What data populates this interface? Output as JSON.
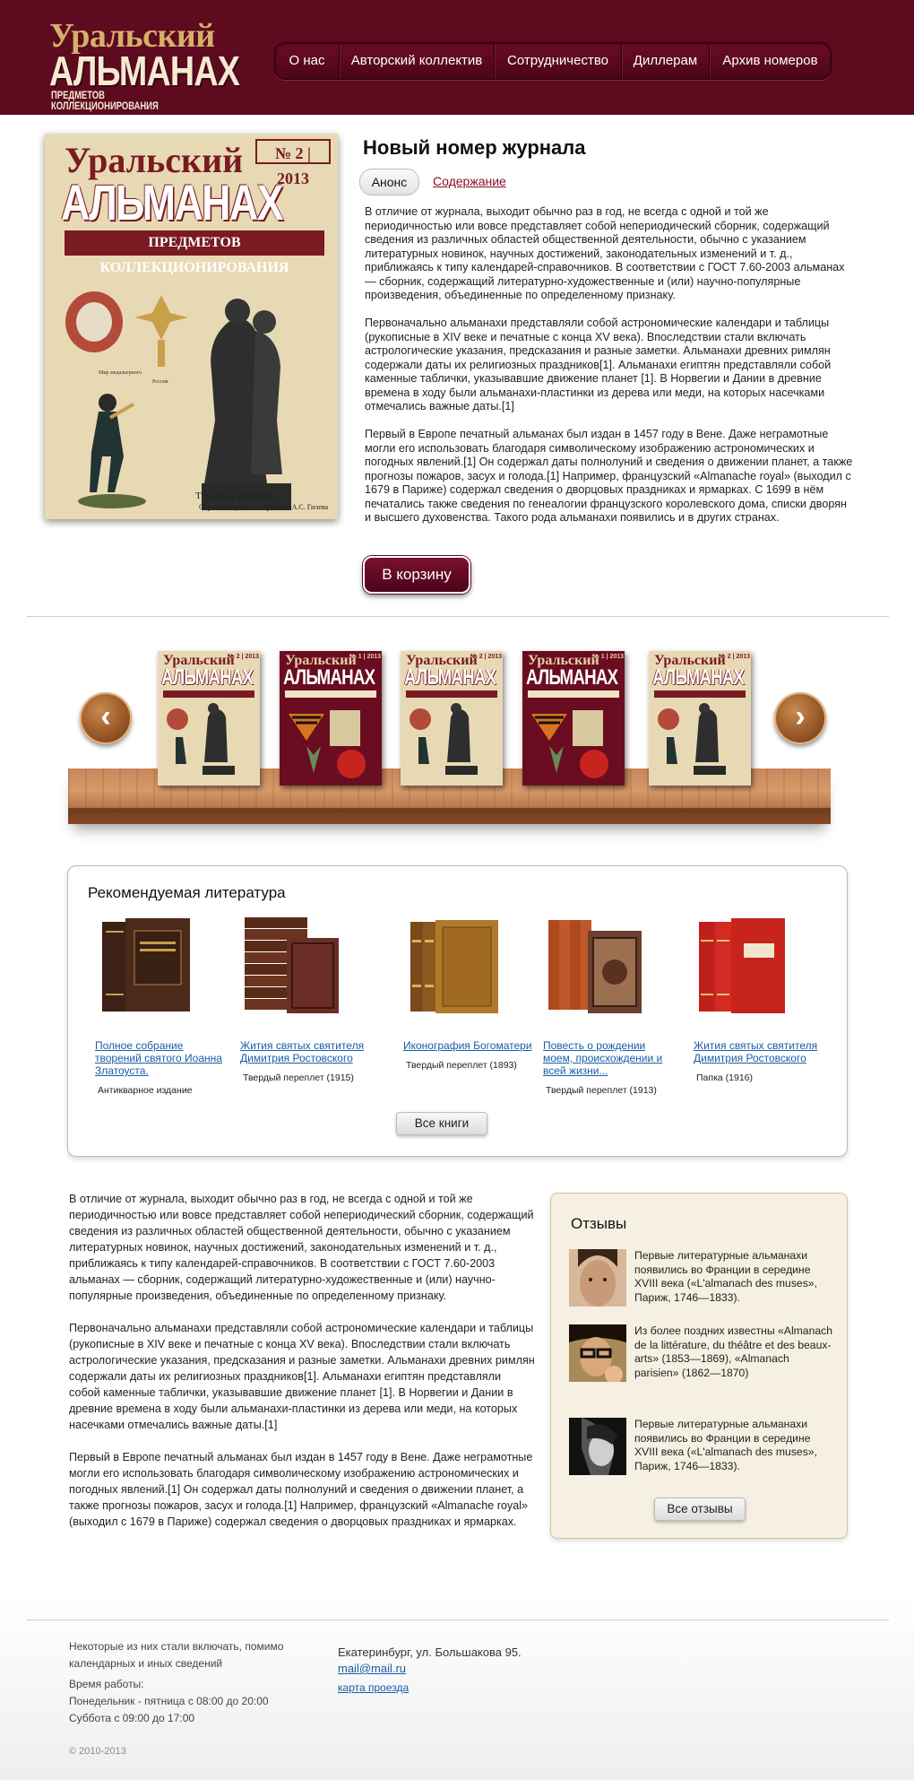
{
  "header": {
    "logo": {
      "line1": "Уральский",
      "line2": "АЛЬМАНАХ",
      "line3": "ПРЕДМЕТОВ КОЛЛЕКЦИОНИРОВАНИЯ"
    },
    "nav": [
      "О нас",
      "Авторский коллектив",
      "Сотрудничество",
      "Диллерам",
      "Архив номеров"
    ]
  },
  "new_issue": {
    "title": "Новый номер журнала",
    "tab_active": "Анонс",
    "tab_link": "Содержание",
    "cover": {
      "title1": "Уральский",
      "number": "№ 2 | 2013",
      "title2": "АЛЬМАНАХ",
      "title3": "ПРЕДМЕТОВ КОЛЛЕКЦИОНИРОВАНИЯ",
      "caption": "Трудовые резервы.",
      "caption2": "Образ молодежи в творчестве А.С. Гилева"
    },
    "paragraphs": [
      "В отличие от журнала, выходит обычно раз в год, не всегда с одной и той же периодичностью или вовсе представляет собой непериодический сборник, содержащий сведения из различных областей общественной деятельности, обычно с указанием литературных новинок, научных достижений, законодательных изменений и т. д., приближаясь к типу календарей-справочников. В соответствии с ГОСТ 7.60-2003 альманах — сборник, содержащий литературно-художественные и (или) научно-популярные произведения, объединенные по определенному признаку.",
      "Первоначально альманахи представляли собой астрономические календари и таблицы (рукописные в XIV веке и печатные с конца XV века). Впоследствии стали включать астрологические указания, предсказания и разные заметки. Альманахи древних римлян содержали даты их религиозных праздников[1]. Альманахи египтян представляли собой каменные таблички, указывавшие движение планет [1]. В Норвегии и Дании в древние времена в ходу были альманахи-пластинки из дерева или меди, на которых насечками отмечались важные даты.[1]",
      "Первый в Европе печатный альманах был издан в 1457 году в Вене. Даже неграмотные могли его использовать благодаря символическому изображению астрономических и погодных явлений.[1] Он содержал даты полнолуний и сведения о движении планет, а также прогнозы пожаров, засух и голода.[1] Например, французский «Almanache royal» (выходил с 1679 в Париже) содержал сведения о дворцовых праздниках и ярмарках. С 1699 в нём печатались также сведения по генеалогии французского королевского дома, списки дворян и высшего духовенства. Такого рода альманахи появились и в других странах."
    ],
    "cart_button": "В корзину"
  },
  "shelf": {
    "prev_icon": "chevron-left-icon",
    "next_icon": "chevron-right-icon",
    "books": [
      {
        "style": "light",
        "t1": "Уральский",
        "t2": "АЛЬМАНАХ",
        "num": "№ 2 | 2013"
      },
      {
        "style": "dark",
        "t1": "Уральский",
        "t2": "АЛЬМАНАХ",
        "num": "№ 1 | 2013"
      },
      {
        "style": "light",
        "t1": "Уральский",
        "t2": "АЛЬМАНАХ",
        "num": "№ 2 | 2013"
      },
      {
        "style": "dark",
        "t1": "Уральский",
        "t2": "АЛЬМАНАХ",
        "num": "№ 1 | 2013"
      },
      {
        "style": "light",
        "t1": "Уральский",
        "t2": "АЛЬМАНАХ",
        "num": "№ 2 | 2013"
      }
    ]
  },
  "recommended": {
    "title": "Рекомендуемая литература",
    "items": [
      {
        "title": "Полное собрание творений святого Иоанна Златоуста.",
        "note": "Антикварное издание"
      },
      {
        "title": "Жития святых святителя Димитрия Ростовского",
        "note": "Твердый переплет (1915)"
      },
      {
        "title": "Иконография Богоматери",
        "note": "Твердый переплет (1893)"
      },
      {
        "title": "Повесть о рождении моем, происхождении и всей жизни...",
        "note": "Твердый переплет (1913)"
      },
      {
        "title": "Жития святых святителя Димитрия Ростовского",
        "note": "Папка (1916)"
      }
    ],
    "all_button": "Все книги"
  },
  "lower_text": [
    "В отличие от журнала, выходит обычно раз в год, не всегда с одной и той же периодичностью или вовсе представляет собой непериодический сборник, содержащий сведения из различных областей общественной деятельности, обычно с указанием литературных новинок, научных достижений, законодательных изменений и т. д., приближаясь к типу календарей-справочников. В соответствии с ГОСТ 7.60-2003 альманах — сборник, содержащий литературно-художественные и (или) научно-популярные произведения, объединенные по определенному признаку.",
    "Первоначально альманахи представляли собой астрономические календари и таблицы (рукописные в XIV веке и печатные с конца XV века). Впоследствии стали включать астрологические указания, предсказания и разные заметки. Альманахи древних римлян содержали даты их религиозных праздников[1]. Альманахи египтян представляли собой каменные таблички, указывавшие движение планет [1]. В Норвегии и Дании в древние времена в ходу были альманахи-пластинки из дерева или меди, на которых насечками отмечались важные даты.[1]",
    "Первый в Европе печатный альманах был издан в 1457 году в Вене. Даже неграмотные могли его использовать благодаря символическому изображению астрономических и погодных явлений.[1] Он содержал даты полнолуний и сведения о движении планет, а также прогнозы пожаров, засух и голода.[1] Например, французский «Almanache royal» (выходил с 1679 в Париже) содержал сведения о дворцовых праздниках и ярмарках."
  ],
  "reviews": {
    "title": "Отзывы",
    "items": [
      "Первые литературные альманахи появились во Франции в середине XVIII века («L'almanach des muses», Париж, 1746—1833).",
      "Из более поздних известны «Almanach de la littérature, du théâtre et des beaux-arts» (1853—1869), «Almanach parisien» (1862—1870)",
      "Первые литературные альманахи появились во Франции в середине XVIII века («L'almanach des muses», Париж, 1746—1833)."
    ],
    "all_button": "Все отзывы"
  },
  "footer": {
    "col1_line1": "Некоторые из них стали включать, помимо",
    "col1_line2": "календарных и иных сведений",
    "hours_label": "Время работы:",
    "hours_weekday": "Понедельник - пятница с 08:00 до 20:00",
    "hours_saturday": "Суббота с 09:00 до 17:00",
    "address": "Екатеринбург, ул. Большакова 95.",
    "email": "mail@mail.ru",
    "map_link": "карта проезда",
    "copyright": "© 2010-2013"
  },
  "colors": {
    "brand": "#5e0a1f",
    "link": "#1a5ca8",
    "review_bg": "#f5f0e2"
  }
}
